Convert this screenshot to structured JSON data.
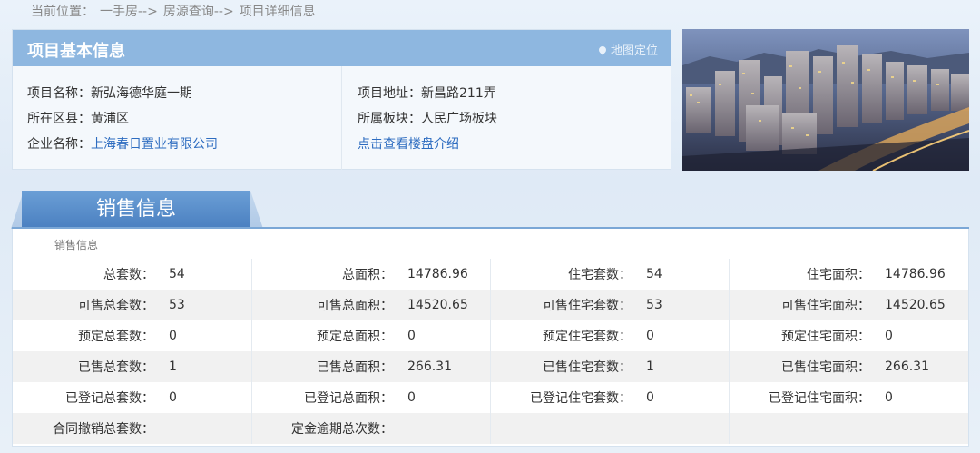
{
  "breadcrumb": {
    "prefix": "当前位置：",
    "items": [
      "一手房-->",
      "房源查询-->",
      "项目详细信息"
    ]
  },
  "project": {
    "title": "项目基本信息",
    "map_link": "地图定位",
    "name_label": "项目名称：",
    "name": "新弘海德华庭一期",
    "district_label": "所在区县：",
    "district": "黄浦区",
    "company_label": "企业名称：",
    "company": "上海春日置业有限公司",
    "address_label": "项目地址：",
    "address": "新昌路211弄",
    "block_label": "所属板块：",
    "block": "人民广场板块",
    "intro_link": "点击查看楼盘介绍"
  },
  "sales": {
    "tab_label": "销售信息",
    "subtitle": "销售信息",
    "rows": [
      [
        [
          "总套数：",
          "54"
        ],
        [
          "总面积：",
          "14786.96"
        ],
        [
          "住宅套数：",
          "54"
        ],
        [
          "住宅面积：",
          "14786.96"
        ]
      ],
      [
        [
          "可售总套数：",
          "53"
        ],
        [
          "可售总面积：",
          "14520.65"
        ],
        [
          "可售住宅套数：",
          "53"
        ],
        [
          "可售住宅面积：",
          "14520.65"
        ]
      ],
      [
        [
          "预定总套数：",
          "0"
        ],
        [
          "预定总面积：",
          "0"
        ],
        [
          "预定住宅套数：",
          "0"
        ],
        [
          "预定住宅面积：",
          "0"
        ]
      ],
      [
        [
          "已售总套数：",
          "1"
        ],
        [
          "已售总面积：",
          "266.31"
        ],
        [
          "已售住宅套数：",
          "1"
        ],
        [
          "已售住宅面积：",
          "266.31"
        ]
      ],
      [
        [
          "已登记总套数：",
          "0"
        ],
        [
          "已登记总面积：",
          "0"
        ],
        [
          "已登记住宅套数：",
          "0"
        ],
        [
          "已登记住宅面积：",
          "0"
        ]
      ],
      [
        [
          "合同撤销总套数：",
          ""
        ],
        [
          "定金逾期总次数：",
          ""
        ],
        [
          "",
          ""
        ],
        [
          "",
          ""
        ]
      ]
    ]
  },
  "colors": {
    "header_bg": "#8eb7e0",
    "tab_bg": "#4a7fc0",
    "link": "#2d6cc0"
  }
}
